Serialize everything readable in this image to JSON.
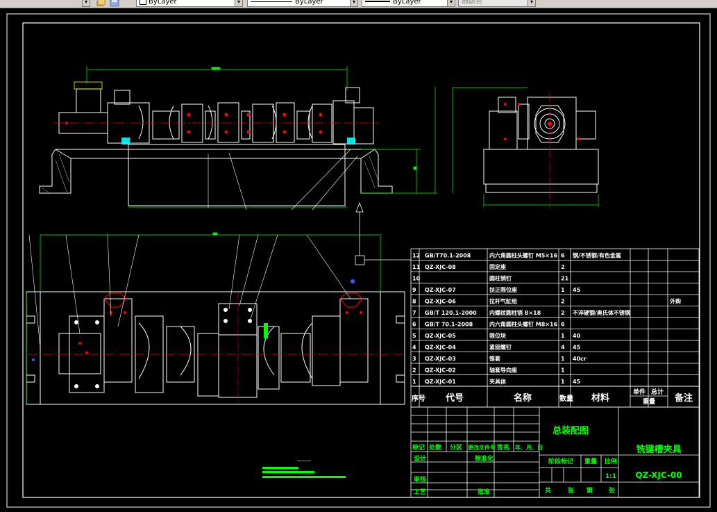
{
  "toolbar": {
    "color_layer": "ByLayer",
    "linetype_layer": "ByLayer",
    "lineweight_layer": "ByLayer",
    "plot_style": "随颜色"
  },
  "bom": [
    {
      "no": "12",
      "code": "GB/T70.1-2008",
      "name": "内六角圆柱头螺钉 M5×16",
      "qty": "6",
      "material": "钢/不锈钢/有色金属",
      "remark": ""
    },
    {
      "no": "11",
      "code": "QZ-XJC-08",
      "name": "固定座",
      "qty": "2",
      "material": "",
      "remark": ""
    },
    {
      "no": "10",
      "code": "",
      "name": "圆柱销钉",
      "qty": "21",
      "material": "",
      "remark": ""
    },
    {
      "no": "9",
      "code": "QZ-XJC-07",
      "name": "扶正限位座",
      "qty": "1",
      "material": "45",
      "remark": ""
    },
    {
      "no": "8",
      "code": "QZ-XJC-06",
      "name": "拉杆气缸组",
      "qty": "2",
      "material": "",
      "remark": "外购"
    },
    {
      "no": "7",
      "code": "GB/T 120.1-2000",
      "name": "内螺纹圆柱销 8×18",
      "qty": "2",
      "material": "不淬硬钢/奥氏体不锈钢",
      "remark": ""
    },
    {
      "no": "6",
      "code": "GB/T 70.1-2008",
      "name": "内六角圆柱头螺钉 M8×16",
      "qty": "6",
      "material": "",
      "remark": ""
    },
    {
      "no": "5",
      "code": "QZ-XJC-05",
      "name": "限位块",
      "qty": "1",
      "material": "40",
      "remark": ""
    },
    {
      "no": "4",
      "code": "QZ-XJC-04",
      "name": "紧固螺钉",
      "qty": "4",
      "material": "45",
      "remark": ""
    },
    {
      "no": "3",
      "code": "QZ-XJC-03",
      "name": "锥套",
      "qty": "1",
      "material": "40cr",
      "remark": ""
    },
    {
      "no": "2",
      "code": "QZ-XJC-02",
      "name": "轴套导向座",
      "qty": "1",
      "material": "",
      "remark": ""
    },
    {
      "no": "1",
      "code": "QZ-XJC-01",
      "name": "夹具体",
      "qty": "1",
      "material": "45",
      "remark": ""
    }
  ],
  "bom_header": {
    "no": "序号",
    "code": "代号",
    "name": "名称",
    "qty": "数量",
    "material": "材料",
    "unit": "单件",
    "total": "总计",
    "weight": "重量",
    "remark": "备注"
  },
  "title_block": {
    "drawing_title": "总装配图",
    "part_name": "铣键槽夹具",
    "drawing_no": "QZ-XJC-00",
    "mark": "标记",
    "count": "处数",
    "zone": "分区",
    "change_doc": "更改文件号",
    "signature": "签名",
    "date": "年、月、日",
    "design": "设计",
    "standardize": "标准化",
    "stage_mark": "阶段标记",
    "weight": "重量",
    "scale": "比例",
    "scale_value": "1:1",
    "review": "审核",
    "process": "工艺",
    "approve": "批准",
    "total": "共",
    "sheets": "张",
    "page": "第",
    "sheet_word": "张"
  },
  "colors": {
    "bg": "#000000",
    "line": "#ffffff",
    "dim": "#00ff00",
    "accent": "#ff0000",
    "blue": "#3060ff",
    "yellow": "#ffff00"
  }
}
